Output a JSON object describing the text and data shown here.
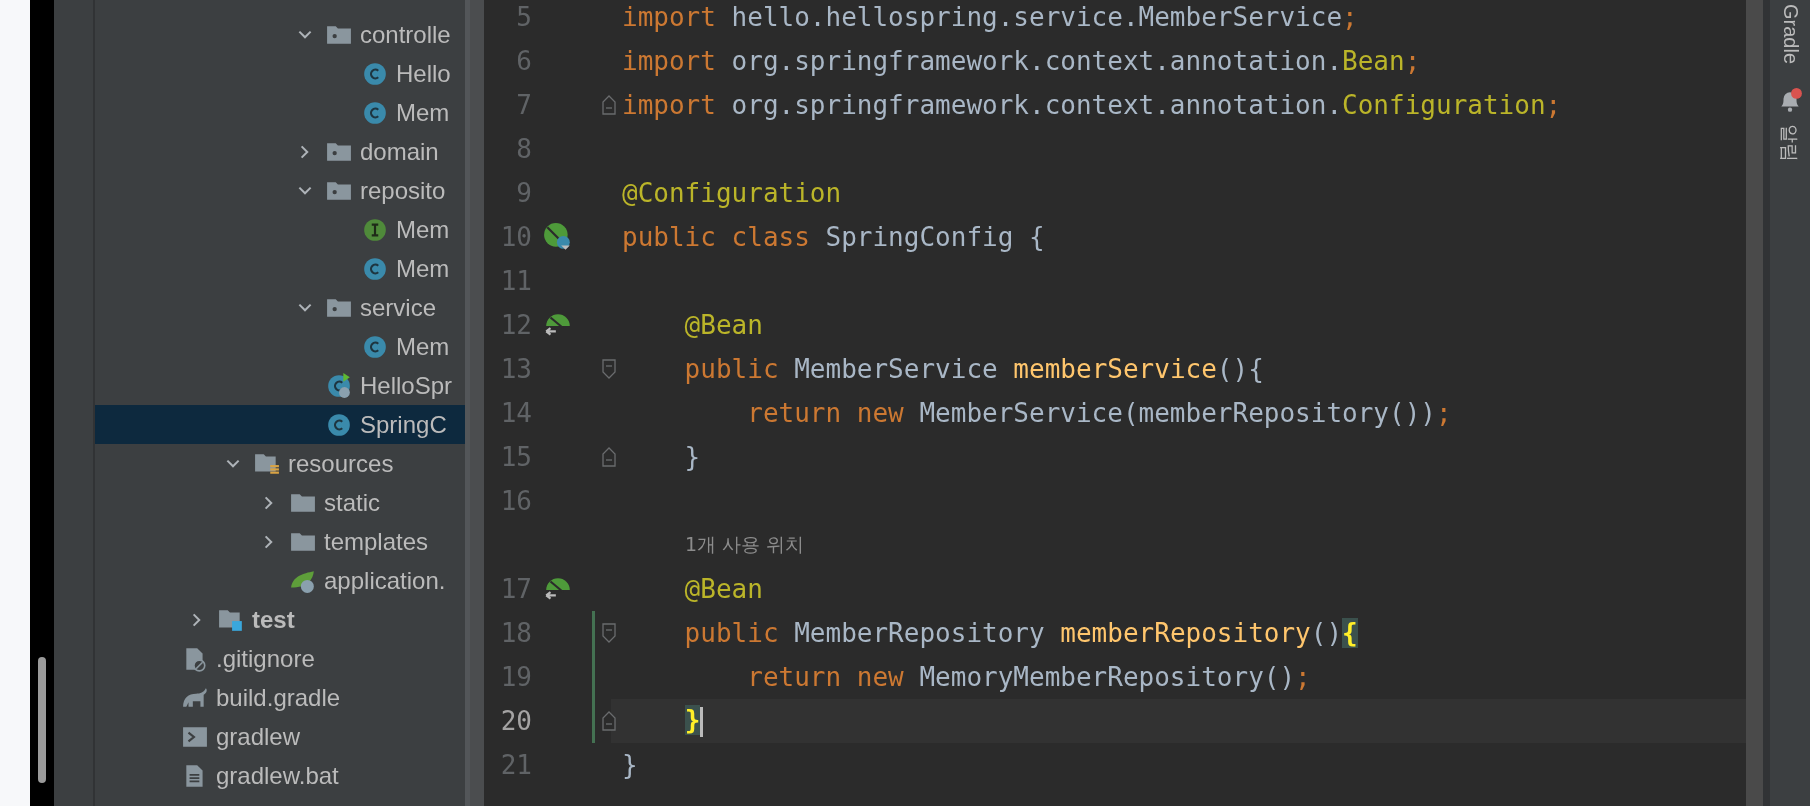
{
  "project_tree": {
    "items": [
      {
        "children": [
          {
            "children": [
              {
                "children": [
                  {
                    "children": [
                      {
                        "children": [
                          {
                            "label": "controlle",
                            "kind": "package",
                            "expanded": true,
                            "selected": false,
                            "children": [
                              {
                                "label": "Hello",
                                "kind": "class",
                                "selected": false
                              },
                              {
                                "label": "Mem",
                                "kind": "class",
                                "selected": false
                              }
                            ]
                          },
                          {
                            "label": "domain",
                            "kind": "package",
                            "expanded": false,
                            "selected": false
                          },
                          {
                            "label": "reposito",
                            "kind": "package",
                            "expanded": true,
                            "selected": false,
                            "children": [
                              {
                                "label": "Mem",
                                "kind": "interface",
                                "selected": false
                              },
                              {
                                "label": "Mem",
                                "kind": "class",
                                "selected": false
                              }
                            ]
                          },
                          {
                            "label": "service",
                            "kind": "package",
                            "expanded": true,
                            "selected": false,
                            "children": [
                              {
                                "label": "Mem",
                                "kind": "class",
                                "selected": false
                              }
                            ]
                          },
                          {
                            "label": "HelloSpr",
                            "kind": "spring-app",
                            "selected": false
                          },
                          {
                            "label": "SpringC",
                            "kind": "class",
                            "selected": true
                          }
                        ]
                      }
                    ]
                  },
                  {
                    "label": "resources",
                    "kind": "resources-folder",
                    "expanded": true,
                    "selected": false,
                    "children": [
                      {
                        "label": "static",
                        "kind": "folder",
                        "expanded": false,
                        "selected": false
                      },
                      {
                        "label": "templates",
                        "kind": "folder",
                        "expanded": false,
                        "selected": false
                      },
                      {
                        "label": "application.",
                        "kind": "spring-properties",
                        "selected": false
                      }
                    ]
                  }
                ]
              },
              {
                "label": "test",
                "kind": "test-folder",
                "expanded": false,
                "selected": false
              }
            ]
          },
          {
            "label": ".gitignore",
            "kind": "ignore-file",
            "selected": false
          },
          {
            "label": "build.gradle",
            "kind": "gradle-file",
            "selected": false
          },
          {
            "label": "gradlew",
            "kind": "script-file",
            "selected": false
          },
          {
            "label": "gradlew.bat",
            "kind": "text-file",
            "selected": false
          }
        ]
      }
    ]
  },
  "editor": {
    "lines": [
      {
        "kind": "code",
        "number": "5",
        "changed": false,
        "current": false,
        "tokens": [
          {
            "text": "import",
            "kind": "keyword"
          },
          {
            "text": " hello.hellospring.service.MemberService",
            "kind": "plain"
          },
          {
            "text": ";",
            "kind": "keyword"
          }
        ]
      },
      {
        "kind": "code",
        "number": "6",
        "changed": false,
        "current": false,
        "tokens": [
          {
            "text": "import",
            "kind": "keyword"
          },
          {
            "text": " org.springframework.context.annotation.",
            "kind": "plain"
          },
          {
            "text": "Bean",
            "kind": "annotation"
          },
          {
            "text": ";",
            "kind": "keyword"
          }
        ]
      },
      {
        "kind": "code",
        "number": "7",
        "changed": false,
        "current": false,
        "fold": {
          "kind": "end"
        },
        "tokens": [
          {
            "text": "import",
            "kind": "keyword"
          },
          {
            "text": " org.springframework.context.annotation.",
            "kind": "plain"
          },
          {
            "text": "Configuration",
            "kind": "annotation"
          },
          {
            "text": ";",
            "kind": "keyword"
          }
        ]
      },
      {
        "kind": "code",
        "number": "8",
        "changed": false,
        "current": false
      },
      {
        "kind": "code",
        "number": "9",
        "changed": false,
        "current": false,
        "tokens": [
          {
            "text": "@Configuration",
            "kind": "annotation"
          }
        ]
      },
      {
        "kind": "code",
        "number": "10",
        "changed": false,
        "current": false,
        "gutter_icon": {
          "kind": "bean-class"
        },
        "tokens": [
          {
            "text": "public class",
            "kind": "keyword"
          },
          {
            "text": " SpringConfig {",
            "kind": "plain"
          }
        ]
      },
      {
        "kind": "code",
        "number": "11",
        "changed": false,
        "current": false
      },
      {
        "kind": "code",
        "number": "12",
        "changed": false,
        "current": false,
        "gutter_icon": {
          "kind": "bean"
        },
        "tokens": [
          {
            "text": "    @Bean",
            "kind": "annotation"
          }
        ]
      },
      {
        "kind": "code",
        "number": "13",
        "changed": false,
        "current": false,
        "fold": {
          "kind": "start"
        },
        "tokens": [
          {
            "text": "    public",
            "kind": "keyword"
          },
          {
            "text": " MemberService ",
            "kind": "plain"
          },
          {
            "text": "memberService",
            "kind": "method"
          },
          {
            "text": "(){",
            "kind": "plain"
          }
        ]
      },
      {
        "kind": "code",
        "number": "14",
        "changed": false,
        "current": false,
        "tokens": [
          {
            "text": "        return new",
            "kind": "keyword"
          },
          {
            "text": " MemberService(memberRepository())",
            "kind": "plain"
          },
          {
            "text": ";",
            "kind": "keyword"
          }
        ]
      },
      {
        "kind": "code",
        "number": "15",
        "changed": false,
        "current": false,
        "fold": {
          "kind": "end"
        },
        "tokens": [
          {
            "text": "    }",
            "kind": "plain"
          }
        ]
      },
      {
        "kind": "code",
        "number": "16",
        "changed": false,
        "current": false
      },
      {
        "kind": "hint",
        "text": "1개 사용 위치"
      },
      {
        "kind": "code",
        "number": "17",
        "changed": false,
        "current": false,
        "gutter_icon": {
          "kind": "bean"
        },
        "tokens": [
          {
            "text": "    @Bean",
            "kind": "annotation"
          }
        ]
      },
      {
        "kind": "code",
        "number": "18",
        "changed": true,
        "current": false,
        "fold": {
          "kind": "start"
        },
        "tokens": [
          {
            "text": "    public",
            "kind": "keyword"
          },
          {
            "text": " MemberRepository ",
            "kind": "plain"
          },
          {
            "text": "memberRepository",
            "kind": "method"
          },
          {
            "text": "()",
            "kind": "plain"
          },
          {
            "text": "{",
            "kind": "brace-match"
          }
        ]
      },
      {
        "kind": "code",
        "number": "19",
        "changed": true,
        "current": false,
        "tokens": [
          {
            "text": "        return new",
            "kind": "keyword"
          },
          {
            "text": " MemoryMemberRepository()",
            "kind": "plain"
          },
          {
            "text": ";",
            "kind": "keyword"
          }
        ]
      },
      {
        "kind": "code",
        "number": "20",
        "changed": true,
        "current": true,
        "fold": {
          "kind": "end"
        },
        "tokens": [
          {
            "text": "    }",
            "kind": "brace-match"
          }
        ]
      },
      {
        "kind": "code",
        "number": "21",
        "changed": false,
        "current": false,
        "tokens": [
          {
            "text": "}",
            "kind": "plain"
          }
        ]
      }
    ]
  },
  "right_toolbar": {
    "gradle": {
      "label": "Gradle"
    },
    "notifications": {
      "label": "알림",
      "unread": true
    }
  }
}
